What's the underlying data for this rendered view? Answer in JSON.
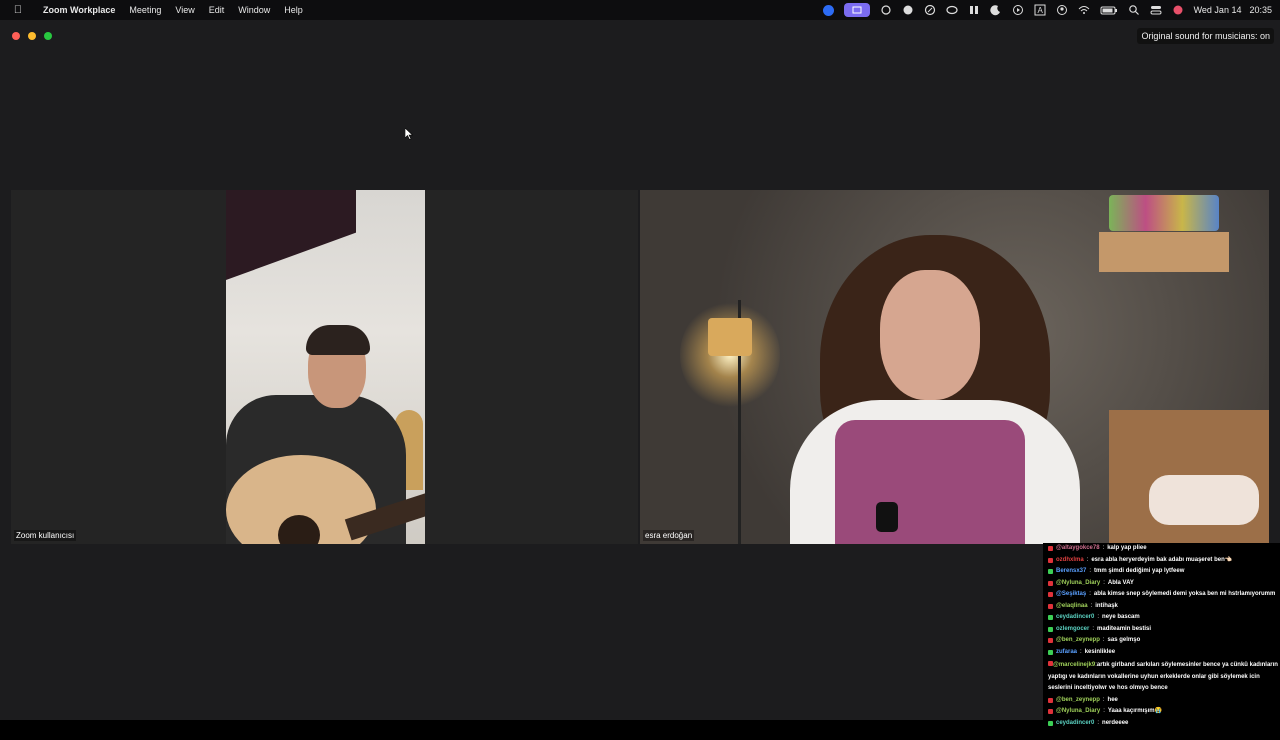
{
  "menubar": {
    "app_name": "Zoom Workplace",
    "menus": [
      "Meeting",
      "View",
      "Edit",
      "Window",
      "Help"
    ],
    "status_icons": [
      "zoom-icon",
      "screen-share-icon",
      "swirl-icon",
      "chatgpt-icon",
      "compass-icon",
      "creative-cloud-icon",
      "airpods-icon",
      "moon-icon",
      "play-circle-icon",
      "text-input-icon",
      "user-circle-icon",
      "wifi-icon",
      "battery-icon",
      "search-icon",
      "control-center-icon",
      "siri-icon"
    ],
    "date": "Wed Jan 14",
    "time": "20:35"
  },
  "window": {
    "original_sound": "Original sound for musicians: on"
  },
  "participants": [
    {
      "name": "Zoom kullanıcısı"
    },
    {
      "name": "esra erdoğan"
    }
  ],
  "chat": {
    "messages": [
      {
        "badge": "r",
        "user": "@altaygokce78",
        "text": "kalp yap pliee",
        "color": "#d07090"
      },
      {
        "badge": "r",
        "user": "ozdhxlma",
        "text": "esra abla heryerdeyim bak adabı muaşeret ben👈🏻",
        "color": "#e04040"
      },
      {
        "badge": "g",
        "user": "Berensx37",
        "text": "tmm şimdi dediğimi yap lytfeew",
        "color": "#5aa0ff"
      },
      {
        "badge": "r",
        "user": "@Nyluna_Diary",
        "text": "Abla VAY",
        "color": "#9fd05a"
      },
      {
        "badge": "r",
        "user": "@Seşiktaş",
        "text": "abla kimse snep söylemedi demi yoksa ben mi hstrlamıyorumm",
        "color": "#5aa0ff"
      },
      {
        "badge": "r",
        "user": "@elaqlinaa",
        "text": "intihaşk",
        "color": "#9fd05a"
      },
      {
        "badge": "g",
        "user": "ceydadincer0",
        "text": "neye bascam",
        "color": "#5ad0c0"
      },
      {
        "badge": "g",
        "user": "ozlemgocer",
        "text": "maditeamin bestisi",
        "color": "#5ad0c0"
      },
      {
        "badge": "r",
        "user": "@ben_zeynepp",
        "text": "sas gelmşo",
        "color": "#9fd05a"
      },
      {
        "badge": "g",
        "user": "zufaraa",
        "text": "kesinliklee",
        "color": "#5aa0ff"
      },
      {
        "badge": "r",
        "user": "@marcelinejk9",
        "text": "artık girlband sarkıları söylemesinler bence ya cünkü kadınların yaptıgı ve kadınların vokallerine uyhun erkeklerde onlar gibi söylemek icin seslerini inceltiyolwr ve hos olmıyo bence",
        "color": "#9fd05a",
        "wrap": true
      },
      {
        "badge": "r",
        "user": "@ben_zeynepp",
        "text": "hee",
        "color": "#9fd05a"
      },
      {
        "badge": "r",
        "user": "@Nyluna_Diary",
        "text": "Yaaa kaçırmışım😭",
        "color": "#9fd05a"
      },
      {
        "badge": "g",
        "user": "ceydadincer0",
        "text": "nerdeeee",
        "color": "#5ad0c0"
      }
    ]
  }
}
